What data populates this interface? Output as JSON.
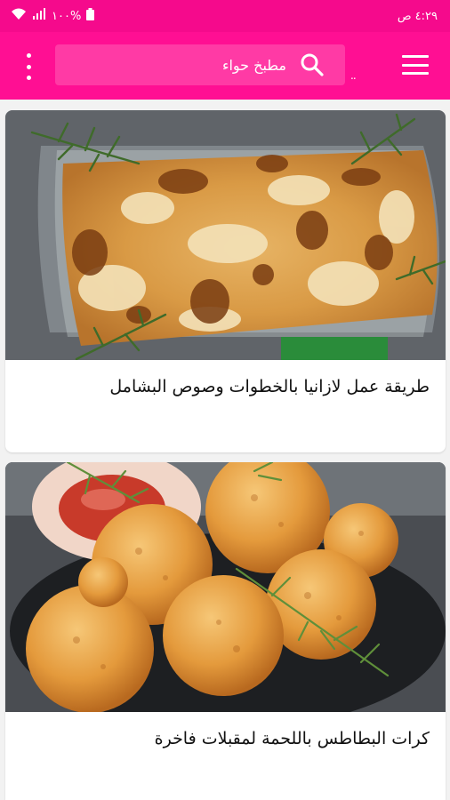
{
  "status_bar": {
    "time": "٤:٢٩ ص",
    "battery": "١٠٠%"
  },
  "app_bar": {
    "search_placeholder": "مطبخ حواء",
    "extra_dots": ".."
  },
  "articles": [
    {
      "title": "طريقة عمل لازانيا بالخطوات وصوص البشامل"
    },
    {
      "title": "كرات البطاطس باللحمة لمقبلات فاخرة"
    }
  ],
  "colors": {
    "brand_pink": "#ff0f93",
    "status_pink": "#f50a8c"
  }
}
